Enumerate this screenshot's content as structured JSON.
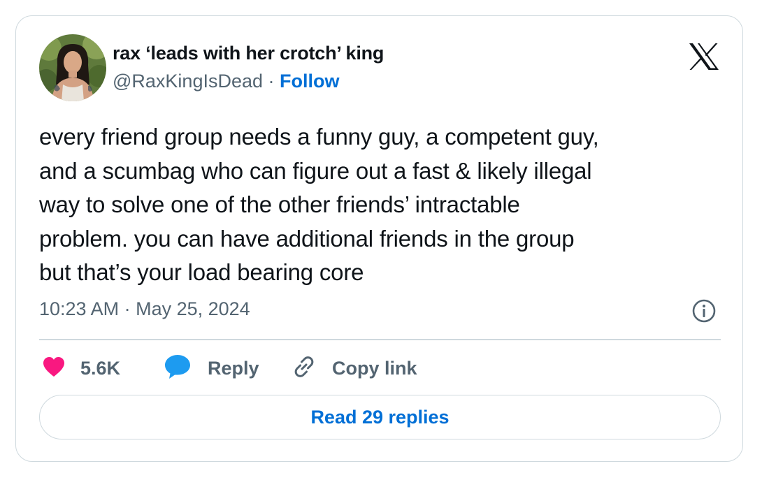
{
  "author": {
    "display_name": "rax ‘leads with her crotch’ king",
    "handle": "@RaxKingIsDead",
    "separator": " · ",
    "follow_label": "Follow",
    "avatar_icon": "profile-photo"
  },
  "brand": {
    "logo_icon": "x-logo-icon"
  },
  "tweet": {
    "lines": [
      "every friend group needs a funny guy, a competent guy,",
      "and a scumbag who can figure out a fast & likely illegal",
      "way to solve one of the other friends’ intractable",
      "problem. you can have additional friends in the group",
      "but that’s your load bearing core"
    ],
    "timestamp": "10:23 AM · May 25, 2024"
  },
  "actions": {
    "like_count": "5.6K",
    "reply_label": "Reply",
    "copy_link_label": "Copy link"
  },
  "read_replies_label": "Read 29 replies",
  "colors": {
    "accent": "#006fd6",
    "like": "#f91880",
    "reply": "#1d9bf0",
    "muted": "#536471",
    "border": "#cfd9de"
  }
}
